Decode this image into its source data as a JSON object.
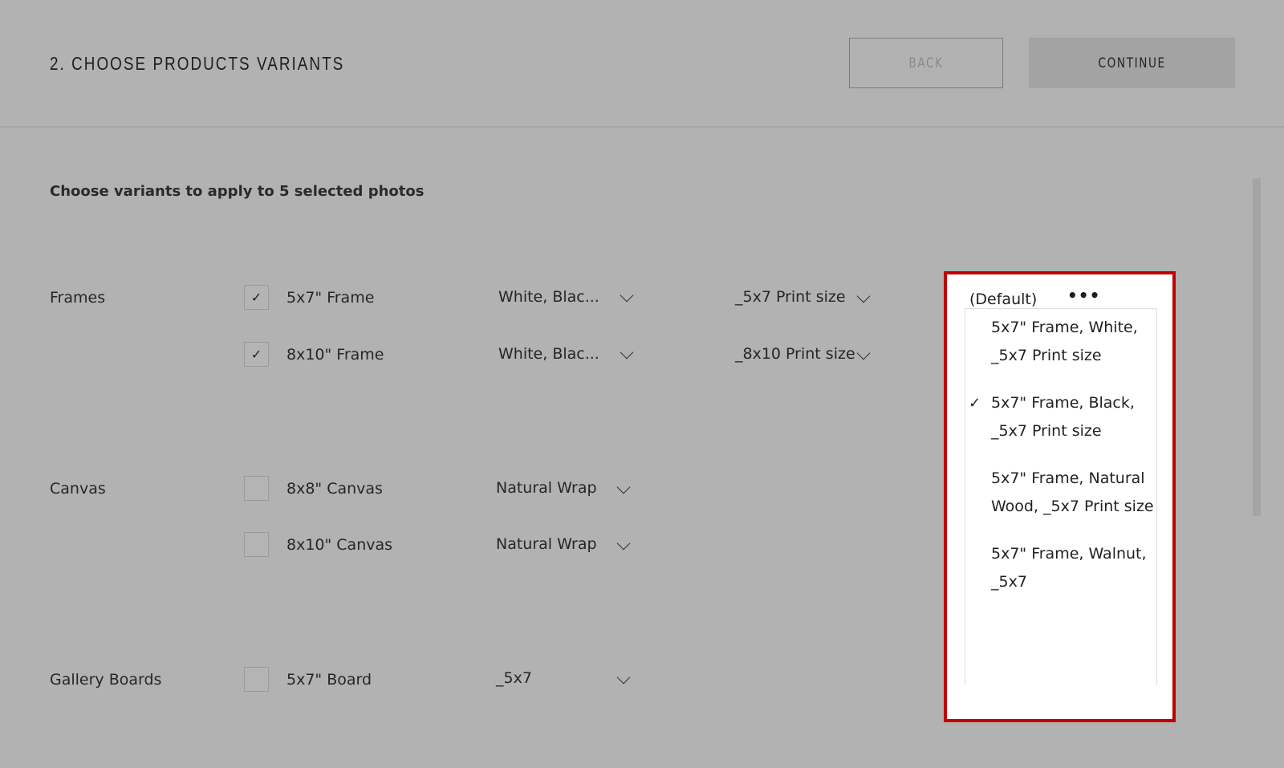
{
  "header": {
    "title": "2. CHOOSE PRODUCTS VARIANTS",
    "back_label": "BACK",
    "continue_label": "CONTINUE"
  },
  "subtitle": "Choose variants to apply to 5 selected photos",
  "groups": [
    {
      "label": "Frames",
      "rows": [
        {
          "name": "5x7\" Frame",
          "checked": true,
          "variant": "White, Blac...",
          "size": "_5x7 Print size"
        },
        {
          "name": "8x10\" Frame",
          "checked": true,
          "variant": "White, Blac...",
          "size": "_8x10 Print size"
        }
      ]
    },
    {
      "label": "Canvas",
      "rows": [
        {
          "name": "8x8\" Canvas",
          "checked": false,
          "variant": "Natural Wrap"
        },
        {
          "name": "8x10\" Canvas",
          "checked": false,
          "variant": "Natural Wrap"
        }
      ]
    },
    {
      "label": "Gallery Boards",
      "rows": [
        {
          "name": "5x7\" Board",
          "checked": false,
          "variant": "_5x7"
        }
      ]
    }
  ],
  "dropdown": {
    "selected": "(Default)",
    "more": "•••",
    "check": "✓",
    "options": [
      "5x7\" Frame, White, _5x7 Print size",
      "5x7\" Frame, Black, _5x7 Print size",
      "5x7\" Frame, Natural Wood, _5x7 Print size",
      "5x7\" Frame, Walnut, _5x7"
    ],
    "checked_index": 1
  },
  "colors": {
    "highlight": "#c00000"
  }
}
